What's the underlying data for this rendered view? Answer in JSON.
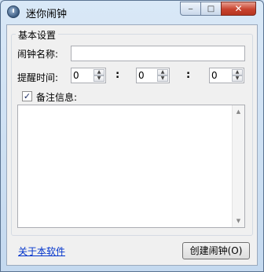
{
  "window": {
    "title": "迷你闹钟",
    "controls": {
      "minimize": "‒",
      "maximize": "□",
      "close": "✕"
    }
  },
  "group": {
    "label": "基本设置"
  },
  "name_field": {
    "label": "闹钟名称:",
    "value": ""
  },
  "remind_time": {
    "label": "提醒时间:",
    "hour": "0",
    "minute": "0",
    "second": "0",
    "separator": ":"
  },
  "note": {
    "label": "备注信息:",
    "checked": true,
    "check_mark": "✓",
    "value": ""
  },
  "spinner": {
    "up": "▲",
    "down": "▼"
  },
  "scrollbar": {
    "up": "▲",
    "down": "▼"
  },
  "footer": {
    "about_link": "关于本软件",
    "create_button": "创建闹钟(O)"
  }
}
